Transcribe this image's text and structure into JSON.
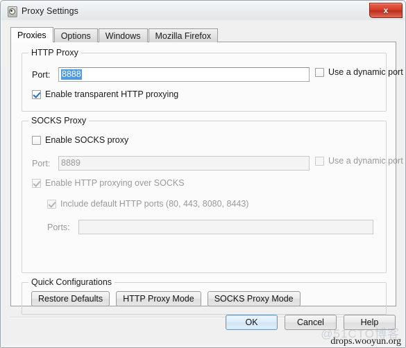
{
  "window": {
    "title": "Proxy Settings",
    "icon": "burp-app-icon",
    "close_label": "x"
  },
  "tabs": [
    {
      "label": "Proxies",
      "active": true
    },
    {
      "label": "Options",
      "active": false
    },
    {
      "label": "Windows",
      "active": false
    },
    {
      "label": "Mozilla Firefox",
      "active": false
    }
  ],
  "http_proxy": {
    "group_title": "HTTP Proxy",
    "port_label": "Port:",
    "port_value": "8888",
    "port_selected": true,
    "dynamic_port_label": "Use a dynamic port",
    "dynamic_port_checked": false,
    "dynamic_port_disabled": false,
    "transparent_label": "Enable transparent HTTP proxying",
    "transparent_checked": true,
    "transparent_disabled": false
  },
  "socks_proxy": {
    "group_title": "SOCKS Proxy",
    "enable_label": "Enable SOCKS proxy",
    "enable_checked": false,
    "enable_disabled": false,
    "port_label": "Port:",
    "port_value": "8889",
    "port_disabled": true,
    "dynamic_port_label": "Use a dynamic port",
    "dynamic_port_checked": false,
    "dynamic_port_disabled": true,
    "http_over_socks_label": "Enable HTTP proxying over SOCKS",
    "http_over_socks_checked": true,
    "http_over_socks_disabled": true,
    "include_default_ports_label": "Include default HTTP ports (80, 443, 8080, 8443)",
    "include_default_ports_checked": true,
    "include_default_ports_disabled": true,
    "ports_label": "Ports:",
    "ports_value": "",
    "ports_disabled": true
  },
  "quick_configurations": {
    "group_title": "Quick Configurations",
    "buttons": [
      {
        "label": "Restore Defaults"
      },
      {
        "label": "HTTP Proxy Mode"
      },
      {
        "label": "SOCKS Proxy Mode"
      }
    ]
  },
  "dialog_buttons": [
    {
      "label": "OK",
      "default": true
    },
    {
      "label": "Cancel",
      "default": false
    },
    {
      "label": "Help",
      "default": false
    }
  ],
  "watermarks": {
    "cto": "@51CTO博客",
    "drops": "drops.wooyun.org"
  }
}
